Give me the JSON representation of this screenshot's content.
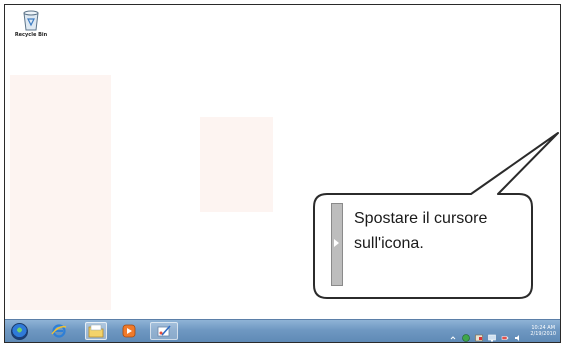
{
  "desktop": {
    "icons": [
      {
        "label": "Recycle Bin"
      }
    ]
  },
  "callout": {
    "text_line1": "Spostare il cursore",
    "text_line2": "sull'icona."
  },
  "taskbar": {
    "pinned": [
      "start-orb",
      "internet-explorer",
      "windows-explorer",
      "media-player",
      "paint"
    ],
    "clock": {
      "time": "10:24 AM",
      "date": "2/19/2010"
    }
  },
  "colors": {
    "taskbar": "#6f98c2",
    "callout_border": "#2b2b2b",
    "tint": "#fdf4f1"
  }
}
